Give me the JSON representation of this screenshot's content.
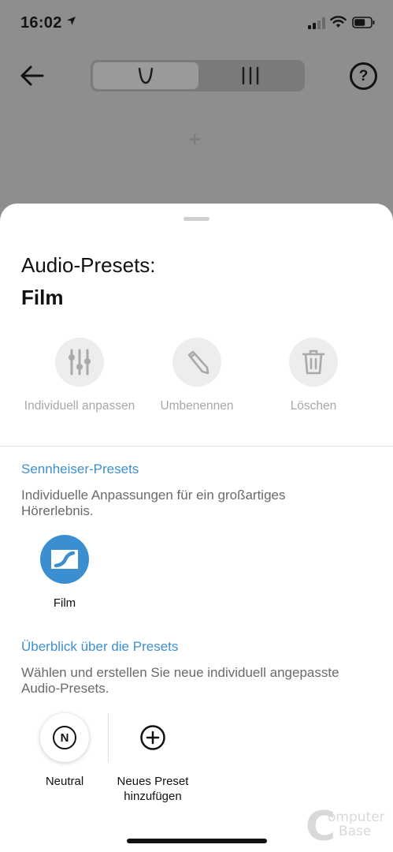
{
  "status_bar": {
    "time": "16:02"
  },
  "top_bar": {
    "help_label": "?",
    "add_glyph": "+"
  },
  "sheet": {
    "title": "Audio-Presets:",
    "subtitle": "Film",
    "actions": [
      {
        "label": "Individuell anpassen",
        "icon": "sliders-icon"
      },
      {
        "label": "Umbenennen",
        "icon": "pencil-icon"
      },
      {
        "label": "Löschen",
        "icon": "trash-icon"
      }
    ],
    "sennheiser_section": {
      "heading": "Sennheiser-Presets",
      "description": "Individuelle Anpassungen für ein großartiges Hörerlebnis.",
      "presets": [
        {
          "label": "Film",
          "icon": "sennheiser-logo-icon"
        }
      ]
    },
    "overview_section": {
      "heading": "Überblick über die Presets",
      "description": "Wählen und erstellen Sie neue individuell angepasste Audio-Presets.",
      "presets": [
        {
          "label": "Neutral",
          "badge": "N"
        },
        {
          "label": "Neues Preset hinzufügen",
          "icon": "plus-circle-icon"
        }
      ]
    }
  },
  "watermark": {
    "line1": "omputer",
    "line2": "Base"
  },
  "colors": {
    "accent": "#3b8ed0",
    "disabled": "#a8a8a8",
    "dim": "#8e8e8e"
  }
}
